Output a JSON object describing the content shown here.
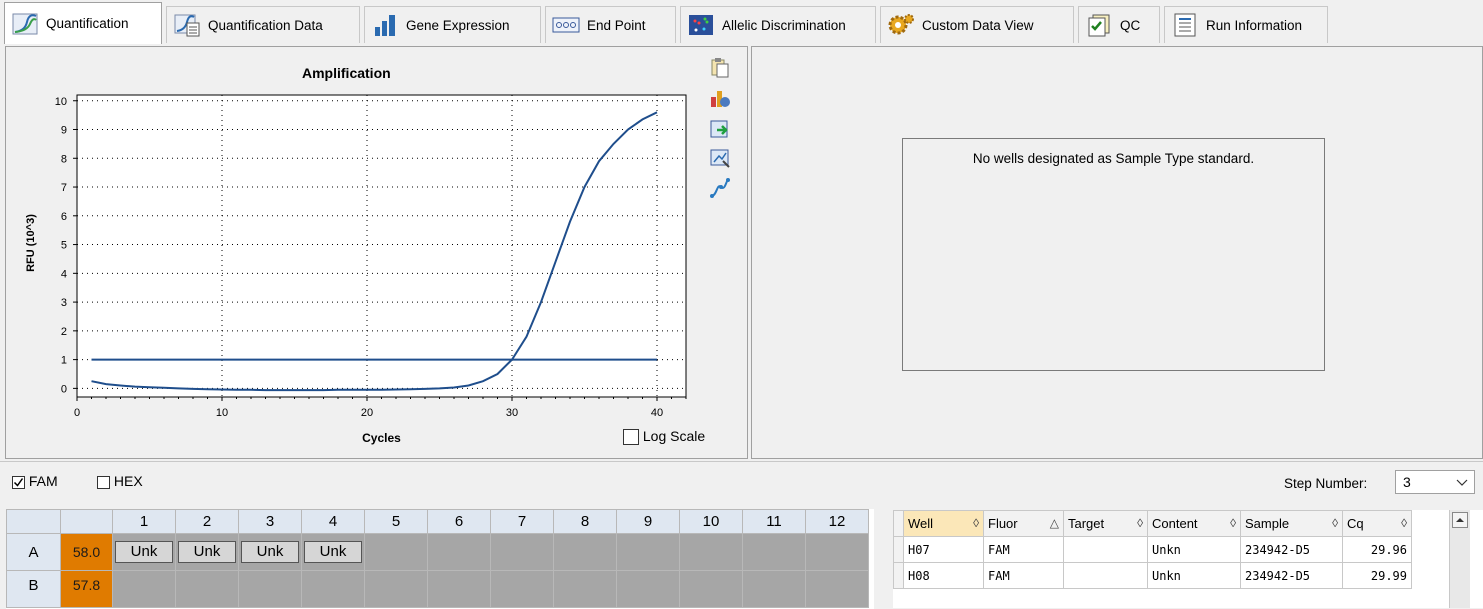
{
  "tabs": [
    {
      "label": "Quantification",
      "icon": "amplification-curve-icon",
      "active": true
    },
    {
      "label": "Quantification Data",
      "icon": "quantification-data-icon"
    },
    {
      "label": "Gene Expression",
      "icon": "bar-chart-icon"
    },
    {
      "label": "End Point",
      "icon": "end-point-icon"
    },
    {
      "label": "Allelic Discrimination",
      "icon": "allelic-discrimination-icon"
    },
    {
      "label": "Custom Data View",
      "icon": "gears-icon"
    },
    {
      "label": "QC",
      "icon": "qc-checklist-icon"
    },
    {
      "label": "Run Information",
      "icon": "run-information-icon"
    }
  ],
  "chart_data": {
    "type": "line",
    "title": "Amplification",
    "xlabel": "Cycles",
    "ylabel": "RFU (10^3)",
    "xlim": [
      0,
      42
    ],
    "ylim": [
      -0.3,
      10.2
    ],
    "xticks": [
      "0",
      "10",
      "20",
      "30",
      "40"
    ],
    "yticks": [
      "0",
      "1",
      "2",
      "3",
      "4",
      "5",
      "6",
      "7",
      "8",
      "9",
      "10"
    ],
    "grid": "dotted",
    "series": [
      {
        "color": "#1f4e8c",
        "x": [
          1,
          2,
          3,
          4,
          5,
          6,
          7,
          8,
          9,
          10,
          11,
          12,
          13,
          14,
          15,
          16,
          17,
          18,
          19,
          20,
          21,
          22,
          23,
          24,
          25,
          26,
          27,
          28,
          29,
          30,
          31,
          32,
          33,
          34,
          35,
          36,
          37,
          38,
          39,
          40
        ],
        "y": [
          0.25,
          0.15,
          0.1,
          0.06,
          0.04,
          0.02,
          0.0,
          -0.02,
          -0.03,
          -0.04,
          -0.05,
          -0.05,
          -0.06,
          -0.06,
          -0.06,
          -0.06,
          -0.06,
          -0.05,
          -0.05,
          -0.05,
          -0.05,
          -0.04,
          -0.03,
          -0.02,
          0.0,
          0.03,
          0.1,
          0.25,
          0.5,
          1.0,
          1.8,
          3.0,
          4.4,
          5.8,
          7.0,
          7.9,
          8.5,
          9.0,
          9.35,
          9.6
        ]
      },
      {
        "color": "#1f4e8c",
        "x": [
          1,
          40
        ],
        "y": [
          1.0,
          1.0
        ]
      }
    ]
  },
  "log_scale": {
    "label": "Log Scale",
    "checked": false
  },
  "chart_tools": [
    "copy-icon",
    "chart-settings-icon",
    "export-icon",
    "zoom-icon",
    "curve-icon"
  ],
  "standard_curve": {
    "message": "No wells designated as Sample Type standard."
  },
  "fluors": [
    {
      "label": "FAM",
      "checked": true
    },
    {
      "label": "HEX",
      "checked": false
    }
  ],
  "step": {
    "label": "Step Number:",
    "value": "3"
  },
  "plate": {
    "columns": [
      "1",
      "2",
      "3",
      "4",
      "5",
      "6",
      "7",
      "8",
      "9",
      "10",
      "11",
      "12"
    ],
    "rows": [
      {
        "label": "A",
        "temp": "58.0",
        "wells": [
          "Unk",
          "Unk",
          "Unk",
          "Unk",
          "",
          "",
          "",
          "",
          "",
          "",
          "",
          ""
        ]
      },
      {
        "label": "B",
        "temp": "57.8",
        "wells": [
          "",
          "",
          "",
          "",
          "",
          "",
          "",
          "",
          "",
          "",
          "",
          ""
        ]
      }
    ]
  },
  "results": {
    "columns": [
      {
        "label": "Well",
        "sort": "◊"
      },
      {
        "label": "Fluor",
        "sort": "△"
      },
      {
        "label": "Target",
        "sort": "◊"
      },
      {
        "label": "Content",
        "sort": "◊"
      },
      {
        "label": "Sample",
        "sort": "◊"
      },
      {
        "label": "Cq",
        "sort": "◊"
      }
    ],
    "rows": [
      [
        "H07",
        "FAM",
        "",
        "Unkn",
        "234942-D5",
        "29.96"
      ],
      [
        "H08",
        "FAM",
        "",
        "Unkn",
        "234942-D5",
        "29.99"
      ]
    ]
  }
}
